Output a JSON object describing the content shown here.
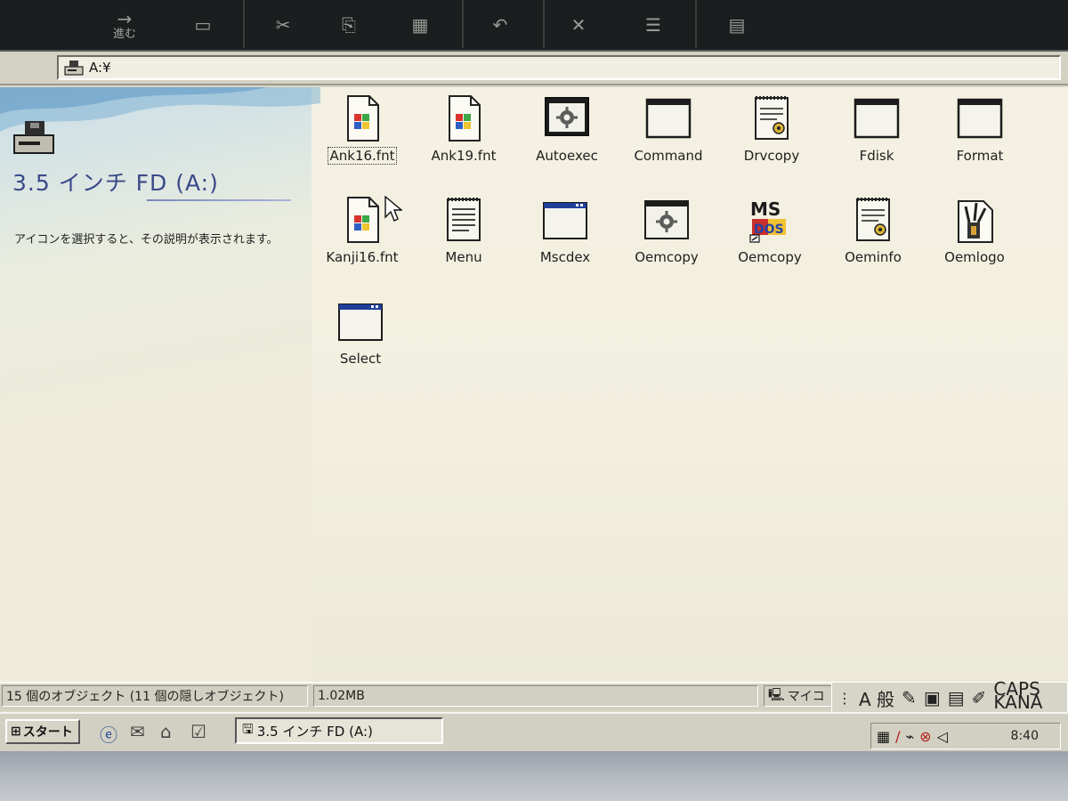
{
  "toolbar": {
    "forward_label": "進む",
    "buttons": [
      {
        "name": "forward",
        "glyph": "→"
      },
      {
        "name": "up-folder",
        "glyph": "▭"
      },
      {
        "name": "cut",
        "glyph": "✂"
      },
      {
        "name": "copy",
        "glyph": "⎘"
      },
      {
        "name": "paste",
        "glyph": "▦"
      },
      {
        "name": "undo",
        "glyph": "↶"
      },
      {
        "name": "delete",
        "glyph": "✕"
      },
      {
        "name": "properties",
        "glyph": "☰"
      },
      {
        "name": "views",
        "glyph": "▤"
      }
    ]
  },
  "address": {
    "path": "A:¥"
  },
  "left_pane": {
    "title": "3.5 インチ FD (A:)",
    "description": "アイコンを選択すると、その説明が表示されます。"
  },
  "files": [
    {
      "label": "Ank16.fnt",
      "type": "font",
      "selected": true
    },
    {
      "label": "Ank19.fnt",
      "type": "font",
      "selected": false
    },
    {
      "label": "Autoexec",
      "type": "batch",
      "selected": false
    },
    {
      "label": "Command",
      "type": "window",
      "selected": false
    },
    {
      "label": "Drvcopy",
      "type": "config",
      "selected": false
    },
    {
      "label": "Fdisk",
      "type": "window",
      "selected": false
    },
    {
      "label": "Format",
      "type": "window",
      "selected": false
    },
    {
      "label": "Kanji16.fnt",
      "type": "font",
      "selected": false
    },
    {
      "label": "Menu",
      "type": "text",
      "selected": false
    },
    {
      "label": "Mscdex",
      "type": "window-bar",
      "selected": false
    },
    {
      "label": "Oemcopy",
      "type": "batch",
      "selected": false
    },
    {
      "label": "Oemcopy",
      "type": "msdos",
      "selected": false
    },
    {
      "label": "Oeminfo",
      "type": "config",
      "selected": false
    },
    {
      "label": "Oemlogo",
      "type": "bitmap",
      "selected": false
    },
    {
      "label": "Select",
      "type": "window-bar",
      "selected": false
    }
  ],
  "status": {
    "objects": "15 個のオブジェクト (11 個の隠しオブジェクト)",
    "size": "1.02MB",
    "zone": "マイコ"
  },
  "ime": {
    "mode": "A 般",
    "caps": "CAPS",
    "kana": "KANA"
  },
  "taskbar": {
    "start_label": "スタート",
    "task_label": "3.5 インチ FD (A:)",
    "clock": "8:40"
  },
  "colors": {
    "title_blue": "#3a4a8a",
    "toolbar_bg": "#1b1d1f",
    "window_bg": "#f2efdf"
  }
}
